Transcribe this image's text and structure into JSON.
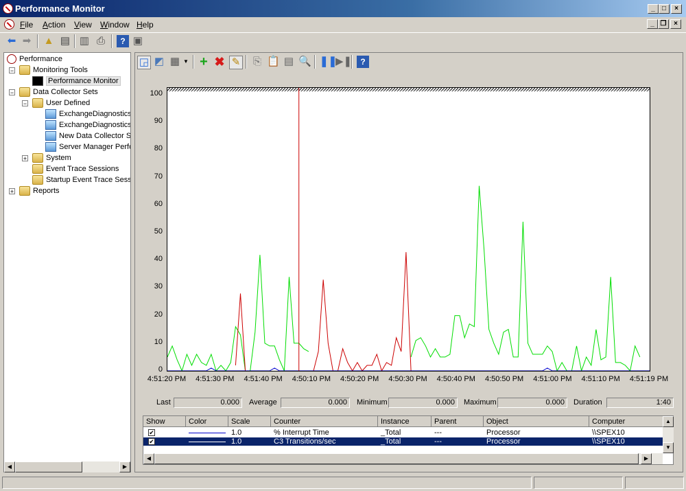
{
  "window": {
    "title": "Performance Monitor"
  },
  "menu": {
    "file": "File",
    "action": "Action",
    "view": "View",
    "window": "Window",
    "help": "Help"
  },
  "tree": {
    "root": "Performance",
    "monitoring_tools": "Monitoring Tools",
    "performance_monitor": "Performance Monitor",
    "data_collector_sets": "Data Collector Sets",
    "user_defined": "User Defined",
    "exchange_diag_1": "ExchangeDiagnosticsD",
    "exchange_diag_2": "ExchangeDiagnosticsP",
    "new_dcs": "New Data Collector Se",
    "server_manager": "Server Manager Perfo",
    "system": "System",
    "event_trace": "Event Trace Sessions",
    "startup_event_trace": "Startup Event Trace Sess",
    "reports": "Reports"
  },
  "stats": {
    "last_label": "Last",
    "last_value": "0.000",
    "average_label": "Average",
    "average_value": "0.000",
    "minimum_label": "Minimum",
    "minimum_value": "0.000",
    "maximum_label": "Maximum",
    "maximum_value": "0.000",
    "duration_label": "Duration",
    "duration_value": "1:40"
  },
  "table": {
    "headers": {
      "show": "Show",
      "color": "Color",
      "scale": "Scale",
      "counter": "Counter",
      "instance": "Instance",
      "parent": "Parent",
      "object": "Object",
      "computer": "Computer"
    },
    "rows": [
      {
        "scale": "1.0",
        "counter": "% Interrupt Time",
        "instance": "_Total",
        "parent": "---",
        "object": "Processor",
        "computer": "\\\\SPEX10",
        "color": "#0000cc"
      },
      {
        "scale": "1.0",
        "counter": "C3 Transitions/sec",
        "instance": "_Total",
        "parent": "---",
        "object": "Processor",
        "computer": "\\\\SPEX10",
        "color": "#ffffff"
      }
    ]
  },
  "chart_data": {
    "type": "line",
    "ylim": [
      0,
      100
    ],
    "yticks": [
      "100",
      "90",
      "80",
      "70",
      "60",
      "50",
      "40",
      "30",
      "20",
      "10",
      "0"
    ],
    "xticks": [
      "4:51:20 PM",
      "4:51:30 PM",
      "4:51:40 PM",
      "4:50:10 PM",
      "4:50:20 PM",
      "4:50:30 PM",
      "4:50:40 PM",
      "4:50:50 PM",
      "4:51:00 PM",
      "4:51:10 PM",
      "4:51:19 PM"
    ],
    "sample_count": 100,
    "series": [
      {
        "color": "#00dd00",
        "segments": [
          {
            "start": 0,
            "values": [
              5,
              9,
              4,
              0,
              6,
              2,
              6,
              3,
              2,
              6,
              0,
              2,
              0,
              3,
              16,
              13,
              0,
              0,
              14,
              42,
              10,
              9,
              9,
              4,
              0,
              34,
              10,
              10,
              8,
              7
            ]
          },
          {
            "start": 50,
            "values": [
              5,
              11,
              12,
              9,
              5,
              8,
              5,
              5,
              6,
              20,
              20,
              12,
              17,
              16,
              67,
              44,
              15,
              10,
              6,
              14,
              15,
              5,
              5,
              54,
              10,
              6,
              6,
              6,
              9,
              7,
              0,
              3,
              0,
              0,
              9,
              0,
              5,
              2,
              15,
              4,
              5,
              34,
              3,
              3,
              2,
              0,
              9,
              5
            ]
          }
        ]
      },
      {
        "color": "#cc0000",
        "segments": [
          {
            "start": 14,
            "values": [
              2,
              28,
              0
            ]
          },
          {
            "start": 27,
            "values": [
              0,
              0,
              0,
              0,
              7,
              33,
              10,
              0,
              0,
              8,
              3,
              0,
              3,
              0,
              2,
              2,
              6,
              0,
              3,
              2,
              12,
              7,
              43,
              0
            ]
          }
        ]
      },
      {
        "color": "#0000cc",
        "segments": [
          {
            "start": 0,
            "values": [
              0,
              0,
              0,
              0,
              0,
              0,
              0,
              0,
              0,
              1,
              0,
              0,
              0,
              0,
              0,
              0,
              0,
              0,
              0,
              0,
              0,
              0,
              1,
              0,
              0,
              0,
              0,
              0,
              0,
              0,
              0,
              0,
              0,
              0,
              0,
              0,
              0,
              0,
              0,
              0,
              0,
              0,
              0,
              0,
              0,
              0,
              0,
              0,
              0,
              0,
              0,
              0,
              0,
              0,
              0,
              0,
              0,
              0,
              0,
              0,
              0,
              0,
              0,
              0,
              0,
              0,
              0,
              0,
              0,
              0,
              0,
              0,
              0,
              0,
              0,
              0,
              0,
              0,
              1,
              0,
              0,
              0,
              0,
              0,
              0,
              0,
              0,
              0,
              0,
              0,
              0,
              0,
              0,
              0,
              0,
              0,
              0,
              0,
              0,
              0
            ]
          }
        ]
      }
    ],
    "current_marker_index": 27
  }
}
